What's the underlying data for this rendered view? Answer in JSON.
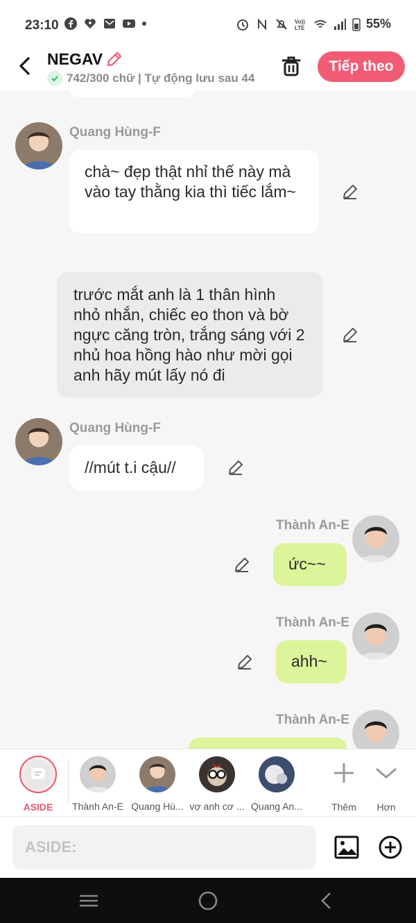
{
  "status_bar": {
    "time": "23:10",
    "battery": "55%",
    "left_icons": [
      "facebook-icon",
      "heart-app-icon",
      "mail-icon",
      "youtube-icon",
      "dot-icon"
    ],
    "right_icons": [
      "alarm-icon",
      "nfc-icon",
      "mute-icon",
      "volte-icon",
      "wifi-icon",
      "signal-icon",
      "battery-icon"
    ]
  },
  "header": {
    "title": "NEGAV",
    "subtitle": "742/300 chữ | Tự động lưu sau 44",
    "next_label": "Tiếp theo"
  },
  "messages": [
    {
      "side": "left",
      "speaker": "Quang Hùng-F",
      "style": "white",
      "text": "chà~ đẹp thật nhỉ thế này mà vào tay thằng kia thì tiếc lắm~"
    },
    {
      "side": "center",
      "speaker": "",
      "style": "gray",
      "text": "trước mắt anh là 1 thân hình nhỏ nhắn, chiếc eo thon và bờ ngực căng tròn, trắng sáng với 2 nhủ hoa hồng hào như mời gọi anh hãy mút lấy nó đi"
    },
    {
      "side": "left",
      "speaker": "Quang Hùng-F",
      "style": "white",
      "text": "//mút t.i cậu//"
    },
    {
      "side": "right",
      "speaker": "Thành An-E",
      "style": "green",
      "text": "ức~~"
    },
    {
      "side": "right",
      "speaker": "Thành An-E",
      "style": "green",
      "text": "ahh~"
    },
    {
      "side": "right",
      "speaker": "Thành An-E",
      "style": "green",
      "text": ""
    }
  ],
  "picker": {
    "items": [
      {
        "label": "ASIDE",
        "active": true
      },
      {
        "label": "Thành An-E"
      },
      {
        "label": "Quang Hù..."
      },
      {
        "label": "vợ anh cơ ..."
      },
      {
        "label": "Quang An..."
      }
    ],
    "more_label": "Thêm",
    "less_label": "Hơn"
  },
  "input": {
    "placeholder": "ASIDE:"
  },
  "colors": {
    "accent": "#f25b74",
    "right_bubble": "#ddf49a",
    "aside_bubble": "#ebebeb",
    "left_bubble": "#ffffff",
    "background": "#f6f6f6"
  }
}
